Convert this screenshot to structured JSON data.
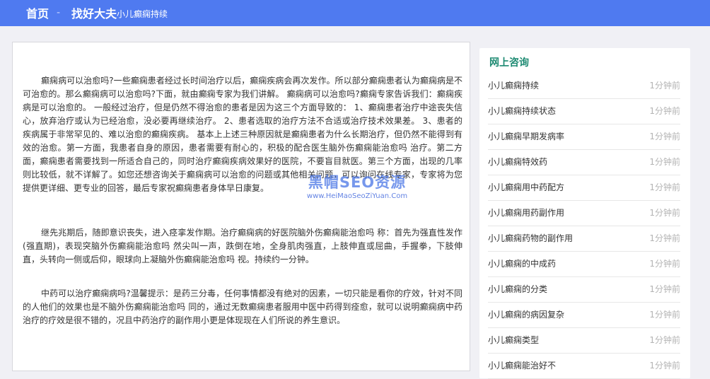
{
  "breadcrumb": {
    "home": "首页",
    "separator": "-",
    "site": "找好大夫",
    "current": "小儿癫痫持续"
  },
  "article": {
    "paragraphs": [
      "癫痫病可以治愈吗?一些癫痫患者经过长时间治疗以后，癫痫疾病会再次发作。所以部分癫痫患者认为癫痫病是不可治愈的。那么癫痫病可以治愈吗?下面，就由癫痫专家为我们讲解。 癫痫病可以治愈吗?癫痫专家告诉我们：癫痫疾病是可以治愈的。 一般经过治疗，但是仍然不得治愈的患者是因为这三个方面导致的： 1、癫痫患者治疗中途丧失信心，放弃治疗或认为已经治愈，没必要再继续治疗。 2、患者选取的治疗方法不合适或治疗技术效果差。 3、患者的疾病属于非常罕见的、难以治愈的癫痫疾病。 基本上上述三种原因就是癫痫患者为什么长期治疗，但仍然不能得到有效的治愈。第一方面，我患者自身的原因，患者需要有耐心的，积极的配合医生脑外伤癫痫能治愈吗 治疗。第二方面，癫痫患者需要找到一所适合自己的，同时治疗癫痫疾病效果好的医院，不要盲目就医。第三个方面，出现的几率则比较低，就不详解了。如您还想咨询关于癫痫病可以治愈的问题或其他相关问题，可以询问在线专家，专家将为您提供更详细、更专业的回答，最后专家祝癫痫患者身体早日康复。",
      "继先兆期后，随即意识丧失，进入痉挛发作期。治疗癫痫病的好医院脑外伤癫痫能治愈吗 称：首先为强直性发作(强直期)，表现突脑外伤癫痫能治愈吗 然尖叫一声，跌倒在地，全身肌肉强直，上肢伸直或屈曲，手握拳，下肢伸直，头转向一侧或后仰，眼球向上凝脑外伤癫痫能治愈吗 视。持续约一分钟。",
      "中药可以治疗癫痫病吗?温馨提示：是药三分毒，任何事情都没有绝对的因素，一切只能是看你的疗效，针对不同的人他们的效果也是不脑外伤癫痫能治愈吗 同的，通过无数癫痫患者服用中医中药得到痊愈，就可以说明癫痫病中药治疗的疗效是很不错的，况且中药治疗的副作用小更是体现现在人们所说的养生意识。"
    ],
    "watermark_title": "黑帽SEO资源",
    "watermark_url": "www.HeiMaoSeoZiYuan.Com"
  },
  "sidebar": {
    "title": "网上咨询",
    "items": [
      {
        "label": "小儿癫痫持续",
        "time": "1分钟前"
      },
      {
        "label": "小儿癫痫持续状态",
        "time": "1分钟前"
      },
      {
        "label": "小儿癫痫早期发病率",
        "time": "1分钟前"
      },
      {
        "label": "小儿癫痫特效药",
        "time": "1分钟前"
      },
      {
        "label": "小儿癫痫用中药配方",
        "time": "1分钟前"
      },
      {
        "label": "小儿癫痫用药副作用",
        "time": "1分钟前"
      },
      {
        "label": "小儿癫痫药物的副作用",
        "time": "1分钟前"
      },
      {
        "label": "小儿癫痫的中成药",
        "time": "1分钟前"
      },
      {
        "label": "小儿癫痫的分类",
        "time": "1分钟前"
      },
      {
        "label": "小儿癫痫的病因复杂",
        "time": "1分钟前"
      },
      {
        "label": "小儿癫痫类型",
        "time": "1分钟前"
      },
      {
        "label": "小儿癫痫能治好不",
        "time": "1分钟前"
      }
    ]
  },
  "colors": {
    "topbar": "#4f7af0",
    "sidebar_title": "#1d8a72",
    "background": "#f0f0f5"
  }
}
